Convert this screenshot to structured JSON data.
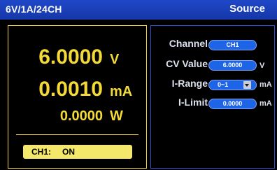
{
  "titlebar": {
    "spec": "6V/1A/24CH",
    "mode": "Source"
  },
  "measurement": {
    "voltage": {
      "value": "6.0000",
      "unit": "V"
    },
    "current": {
      "value": "0.0010",
      "unit": "mA"
    },
    "power": {
      "value": "0.0000",
      "unit": "W"
    },
    "status": {
      "channel": "CH1:",
      "state": "ON"
    }
  },
  "settings": {
    "channel": {
      "label": "Channel",
      "value": "CH1"
    },
    "cv_value": {
      "label": "CV Value",
      "value": "6.0000",
      "unit": "V"
    },
    "i_range": {
      "label": "I-Range",
      "value": "0~1",
      "unit": "mA"
    },
    "i_limit": {
      "label": "I-Limit",
      "value": "0.0000",
      "unit": "mA"
    }
  },
  "colors": {
    "titlebar": "#1f47c8",
    "measurement_text": "#f3da37",
    "status_badge": "#f4e86a",
    "settings_border": "#2a55d6",
    "pill": "#1e64e6"
  },
  "icons": {
    "dropdown": "chevron-down-icon"
  }
}
